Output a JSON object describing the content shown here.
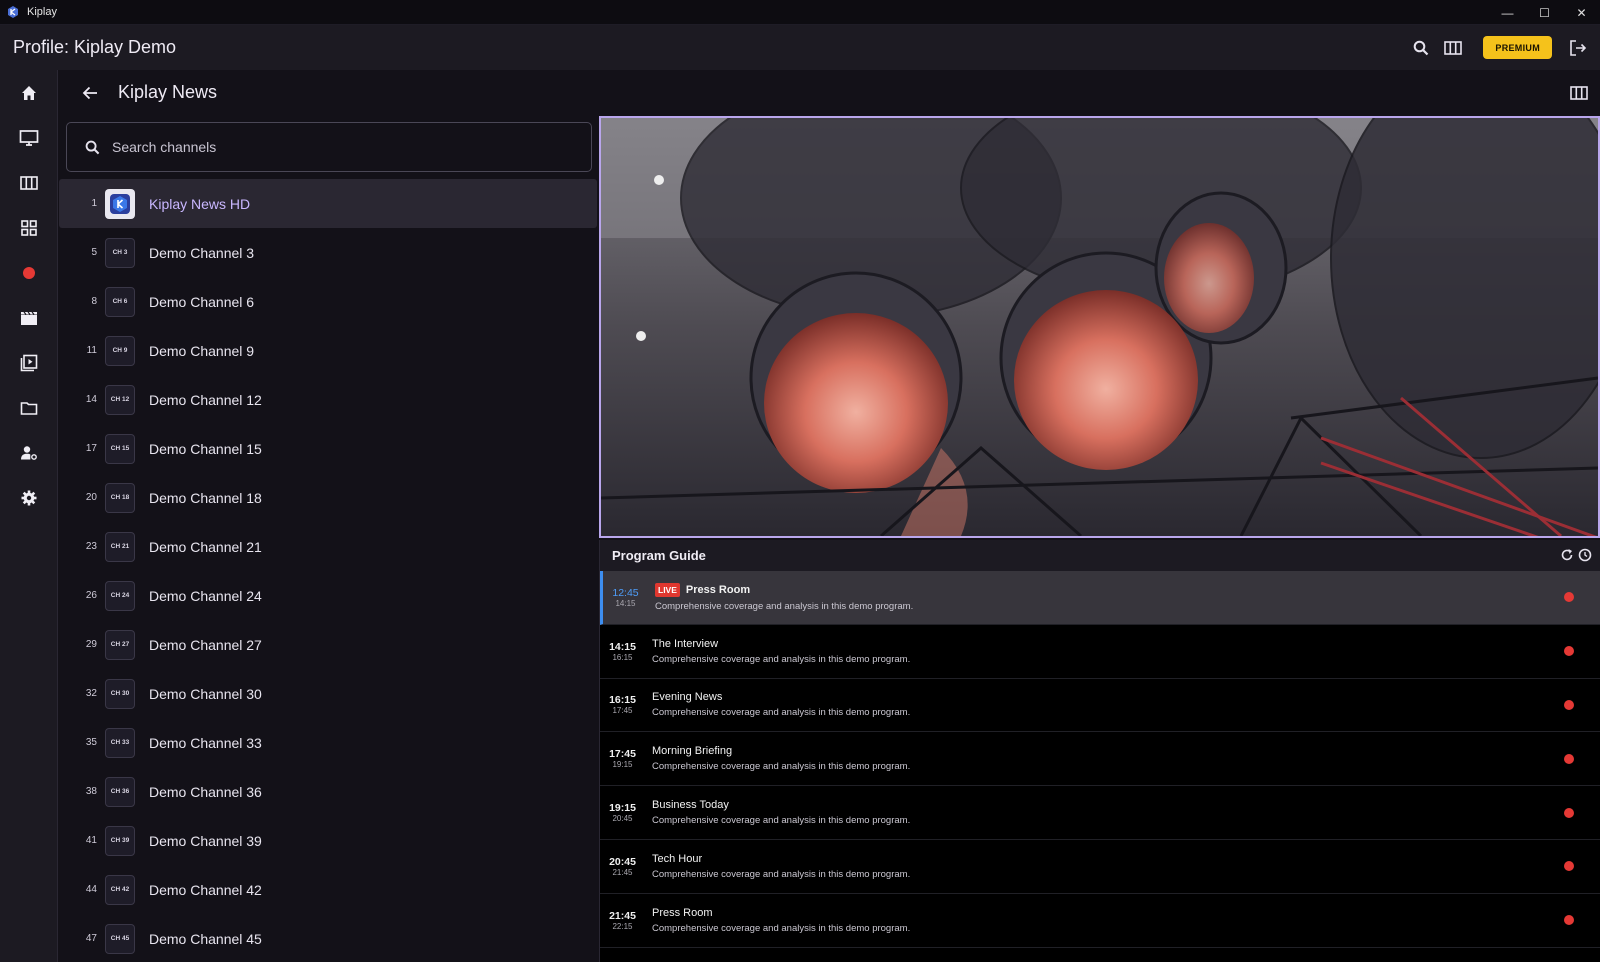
{
  "window": {
    "title": "Kiplay",
    "controls": [
      "—",
      "☐",
      "✕"
    ]
  },
  "header": {
    "profile_label": "Profile: Kiplay Demo",
    "premium_label": "PREMIUM"
  },
  "channel_group": {
    "title": "Kiplay News"
  },
  "search": {
    "placeholder": "Search channels"
  },
  "channels": [
    {
      "num": "1",
      "logo": "",
      "name": "Kiplay News HD"
    },
    {
      "num": "5",
      "logo": "CH 3",
      "name": "Demo Channel 3"
    },
    {
      "num": "8",
      "logo": "CH 6",
      "name": "Demo Channel 6"
    },
    {
      "num": "11",
      "logo": "CH 9",
      "name": "Demo Channel 9"
    },
    {
      "num": "14",
      "logo": "CH 12",
      "name": "Demo Channel 12"
    },
    {
      "num": "17",
      "logo": "CH 15",
      "name": "Demo Channel 15"
    },
    {
      "num": "20",
      "logo": "CH 18",
      "name": "Demo Channel 18"
    },
    {
      "num": "23",
      "logo": "CH 21",
      "name": "Demo Channel 21"
    },
    {
      "num": "26",
      "logo": "CH 24",
      "name": "Demo Channel 24"
    },
    {
      "num": "29",
      "logo": "CH 27",
      "name": "Demo Channel 27"
    },
    {
      "num": "32",
      "logo": "CH 30",
      "name": "Demo Channel 30"
    },
    {
      "num": "35",
      "logo": "CH 33",
      "name": "Demo Channel 33"
    },
    {
      "num": "38",
      "logo": "CH 36",
      "name": "Demo Channel 36"
    },
    {
      "num": "41",
      "logo": "CH 39",
      "name": "Demo Channel 39"
    },
    {
      "num": "44",
      "logo": "CH 42",
      "name": "Demo Channel 42"
    },
    {
      "num": "47",
      "logo": "CH 45",
      "name": "Demo Channel 45"
    }
  ],
  "guide": {
    "title": "Program Guide",
    "live_label": "LIVE",
    "programs": [
      {
        "start": "12:45",
        "end": "14:15",
        "title": "Press Room",
        "desc": "Comprehensive coverage and analysis in this demo program."
      },
      {
        "start": "14:15",
        "end": "16:15",
        "title": "The Interview",
        "desc": "Comprehensive coverage and analysis in this demo program."
      },
      {
        "start": "16:15",
        "end": "17:45",
        "title": "Evening News",
        "desc": "Comprehensive coverage and analysis in this demo program."
      },
      {
        "start": "17:45",
        "end": "19:15",
        "title": "Morning Briefing",
        "desc": "Comprehensive coverage and analysis in this demo program."
      },
      {
        "start": "19:15",
        "end": "20:45",
        "title": "Business Today",
        "desc": "Comprehensive coverage and analysis in this demo program."
      },
      {
        "start": "20:45",
        "end": "21:45",
        "title": "Tech Hour",
        "desc": "Comprehensive coverage and analysis in this demo program."
      },
      {
        "start": "21:45",
        "end": "22:15",
        "title": "Press Room",
        "desc": "Comprehensive coverage and analysis in this demo program."
      }
    ]
  },
  "colors": {
    "accent": "#b9a6ec",
    "premium": "#f5c21b",
    "live": "#e0372f",
    "record": "#e53935",
    "time_live": "#4e9df8"
  },
  "icons": {
    "nav": [
      "home-icon",
      "tv-icon",
      "guide-grid-icon",
      "dashboard-icon",
      "record-icon",
      "movies-icon",
      "series-icon",
      "folder-icon",
      "user-settings-icon",
      "settings-icon"
    ],
    "header": [
      "search-icon",
      "columns-icon",
      "logout-icon"
    ]
  }
}
